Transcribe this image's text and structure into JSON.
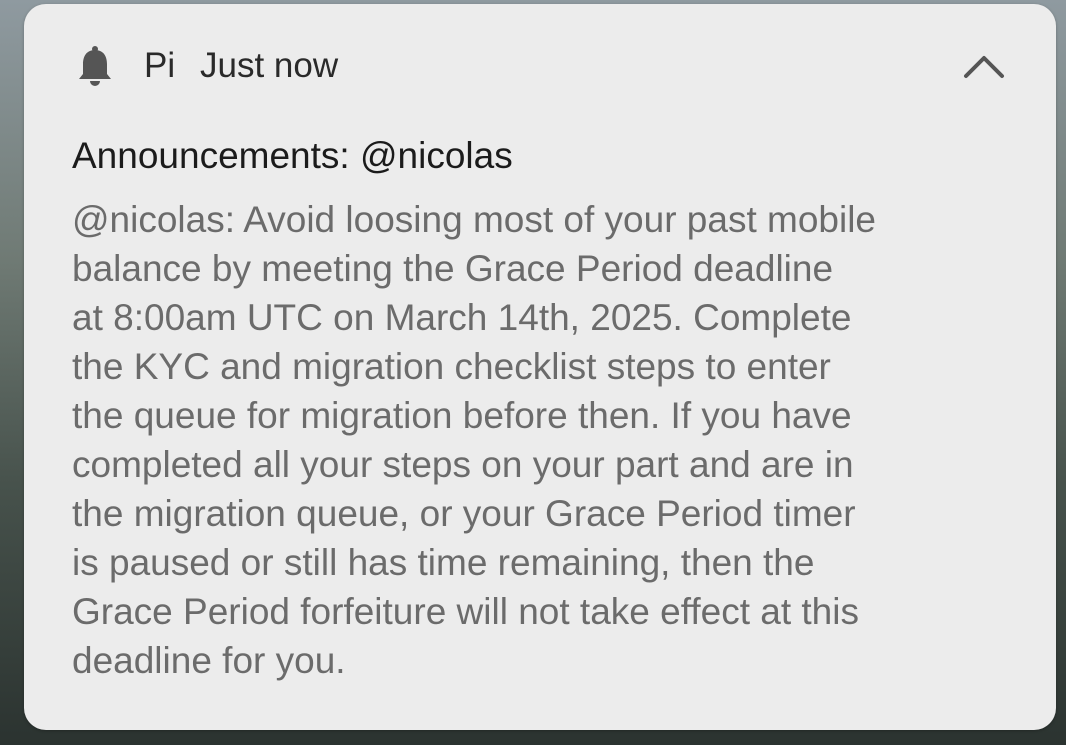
{
  "notification": {
    "app_icon": "bell-icon",
    "app_name": "Pi",
    "time": "Just now",
    "collapse_icon": "chevron-up-icon",
    "title": "Announcements: @nicolas",
    "body_lines": [
      "@nicolas: Avoid loosing most of your past mobile",
      "balance by meeting the Grace Period deadline",
      "at 8:00am UTC on March 14th, 2025. Complete",
      "the KYC and migration checklist steps to enter",
      "the queue for migration before then. If you have",
      "completed all your steps on your part and are in",
      "the migration queue, or your Grace Period timer",
      "is paused or still has time remaining, then the",
      "Grace Period forfeiture will not take effect at this",
      "deadline for you."
    ]
  },
  "colors": {
    "card_background": "#ececec",
    "title_text": "#1b1b1b",
    "body_text": "#6b6b6b",
    "icon": "#555555"
  }
}
